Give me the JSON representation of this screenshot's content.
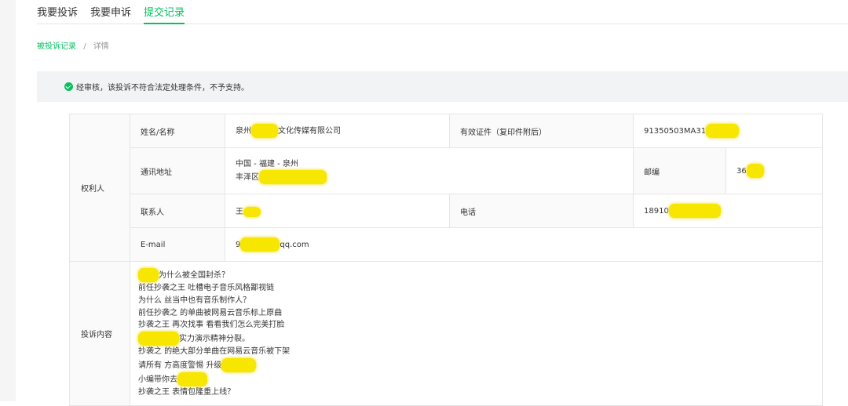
{
  "tabs": [
    {
      "label": "我要投诉",
      "active": false
    },
    {
      "label": "我要申诉",
      "active": false
    },
    {
      "label": "提交记录",
      "active": true
    }
  ],
  "breadcrumb": {
    "parent": "被投诉记录",
    "separator": "/",
    "current": "详情"
  },
  "notice": {
    "text": "经审核，该投诉不符合法定处理条件，不予支持。"
  },
  "colors": {
    "accent": "#07c160",
    "redaction": "#f7e600"
  },
  "rightholder": {
    "section_label": "权利人",
    "name_label": "姓名/名称",
    "name_value_pre": "泉州",
    "name_value_post": "文化传媒有限公司",
    "id_label": "有效证件（复印件附后）",
    "id_value": "91350503MA31",
    "address_label": "通讯地址",
    "address_line1": "中国 - 福建 - 泉州",
    "address_line2": "丰泽区",
    "postcode_label": "邮编",
    "postcode_value": "36",
    "contact_label": "联系人",
    "contact_value": "王",
    "phone_label": "电话",
    "phone_value": "18910",
    "email_label": "E-mail",
    "email_value_pre": "9",
    "email_value_post": "qq.com"
  },
  "complaint": {
    "section_label": "投诉内容",
    "lines": [
      "为什么被全国封杀？",
      "前任抄袭之王 吐槽电子音乐风格鄙视链",
      "为什么 丝当中也有音乐制作人？",
      "前任抄袭之 的单曲被网易云音乐标上原曲",
      "抄袭之王 再次找事 看看我们怎么完美打脸",
      "实力演示精神分裂。",
      "抄袭之 的绝大部分单曲在网易云音乐被下架",
      "请所有 方高度警惕 升级",
      "小编带你去",
      "抄袭之王 表情包隆重上线？"
    ]
  }
}
